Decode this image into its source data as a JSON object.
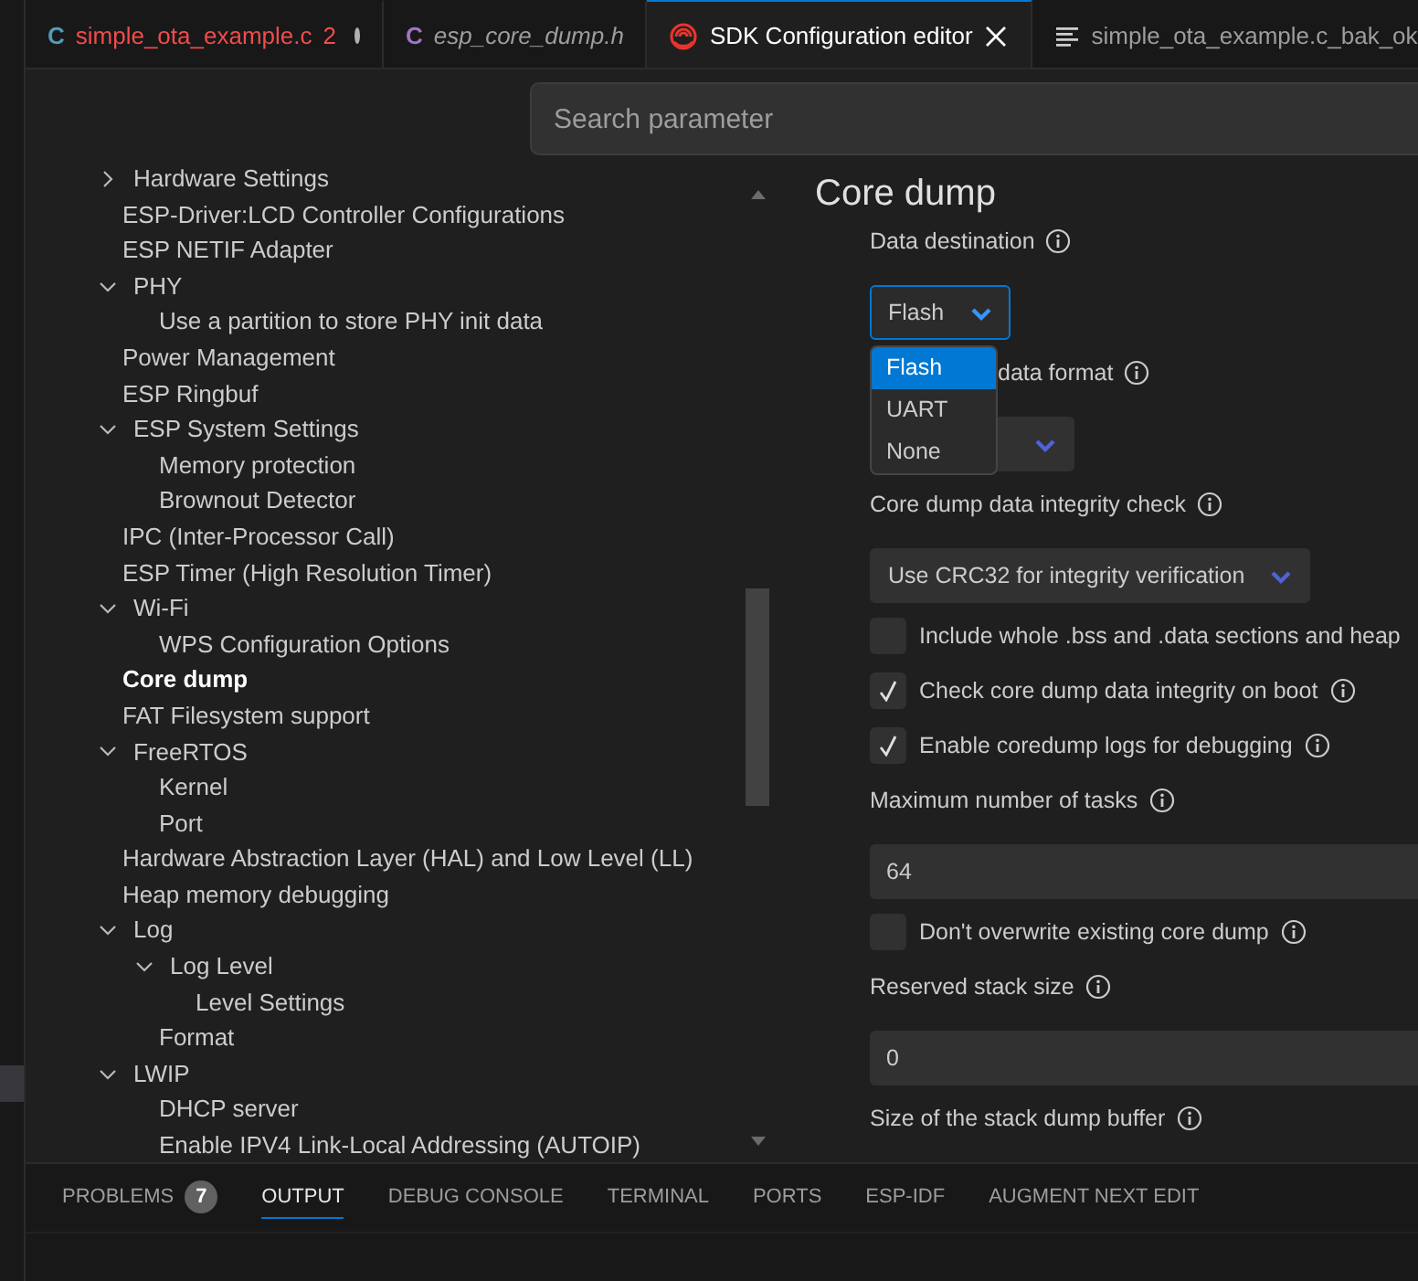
{
  "tabs": [
    {
      "kind": "source",
      "letter": "C",
      "color": "#519aba",
      "label": "simple_ota_example.c",
      "count": "2",
      "errors": true,
      "modified": true,
      "selected": false
    },
    {
      "kind": "source",
      "letter": "C",
      "color": "#a074c4",
      "label": "esp_core_dump.h",
      "preview": true,
      "selected": false
    },
    {
      "kind": "config",
      "label": "SDK Configuration editor",
      "closable": true,
      "selected": true
    },
    {
      "kind": "text",
      "label": "simple_ota_example.c_bak_ok",
      "selected": false
    }
  ],
  "search": {
    "placeholder": "Search parameter"
  },
  "tree": [
    {
      "label": "Hardware Settings",
      "expanded": false,
      "selected": false
    },
    {
      "label": "ESP-Driver:LCD Controller Configurations",
      "selected": false
    },
    {
      "label": "ESP NETIF Adapter",
      "selected": false
    },
    {
      "label": "PHY",
      "expanded": true,
      "selected": false,
      "children": [
        {
          "label": "Use a partition to store PHY init data",
          "selected": false
        }
      ]
    },
    {
      "label": "Power Management",
      "selected": false
    },
    {
      "label": "ESP Ringbuf",
      "selected": false
    },
    {
      "label": "ESP System Settings",
      "expanded": true,
      "selected": false,
      "children": [
        {
          "label": "Memory protection",
          "selected": false
        },
        {
          "label": "Brownout Detector",
          "selected": false
        }
      ]
    },
    {
      "label": "IPC (Inter-Processor Call)",
      "selected": false
    },
    {
      "label": "ESP Timer (High Resolution Timer)",
      "selected": false
    },
    {
      "label": "Wi-Fi",
      "expanded": true,
      "selected": false,
      "children": [
        {
          "label": "WPS Configuration Options",
          "selected": false
        }
      ]
    },
    {
      "label": "Core dump",
      "selected": true
    },
    {
      "label": "FAT Filesystem support",
      "selected": false
    },
    {
      "label": "FreeRTOS",
      "expanded": true,
      "selected": false,
      "children": [
        {
          "label": "Kernel",
          "selected": false
        },
        {
          "label": "Port",
          "selected": false
        }
      ]
    },
    {
      "label": "Hardware Abstraction Layer (HAL) and Low Level (LL)",
      "selected": false
    },
    {
      "label": "Heap memory debugging",
      "selected": false
    },
    {
      "label": "Log",
      "expanded": true,
      "selected": false,
      "children": [
        {
          "label": "Log Level",
          "expanded": true,
          "selected": false,
          "children": [
            {
              "label": "Level Settings",
              "selected": false
            }
          ]
        },
        {
          "label": "Format",
          "selected": false
        }
      ]
    },
    {
      "label": "LWIP",
      "expanded": true,
      "selected": false,
      "children": [
        {
          "label": "DHCP server",
          "selected": false
        },
        {
          "label": "Enable IPV4 Link-Local Addressing (AUTOIP)",
          "selected": false
        }
      ]
    }
  ],
  "section": {
    "title": "Core dump",
    "items": [
      {
        "kind": "select",
        "label": "Data destination",
        "info": true,
        "value": "Flash",
        "open": true,
        "options": [
          {
            "label": "Flash",
            "selected": true
          },
          {
            "label": "UART",
            "selected": false
          },
          {
            "label": "None",
            "selected": false
          }
        ]
      },
      {
        "kind": "select",
        "label": "data format",
        "info": true
      },
      {
        "kind": "select",
        "label": "Core dump data integrity check",
        "info": true,
        "value": "Use CRC32 for integrity verification"
      },
      {
        "kind": "checkbox",
        "label": "Include whole .bss and .data sections and heap",
        "checked": false
      },
      {
        "kind": "checkbox",
        "label": "Check core dump data integrity on boot",
        "info": true,
        "checked": true
      },
      {
        "kind": "checkbox",
        "label": "Enable coredump logs for debugging",
        "info": true,
        "checked": true
      },
      {
        "kind": "number",
        "label": "Maximum number of tasks",
        "info": true,
        "value": "64"
      },
      {
        "kind": "checkbox",
        "label": "Don't overwrite existing core dump",
        "info": true,
        "checked": false
      },
      {
        "kind": "number",
        "label": "Reserved stack size",
        "info": true,
        "value": "0"
      },
      {
        "kind": "label",
        "label": "Size of the stack dump buffer",
        "info": true
      }
    ]
  },
  "panel_tabs": [
    {
      "label": "PROBLEMS",
      "badge": "7",
      "selected": false
    },
    {
      "label": "OUTPUT",
      "selected": true
    },
    {
      "label": "DEBUG CONSOLE",
      "selected": false
    },
    {
      "label": "TERMINAL",
      "selected": false
    },
    {
      "label": "PORTS",
      "selected": false
    },
    {
      "label": "ESP-IDF",
      "selected": false
    },
    {
      "label": "AUGMENT NEXT EDIT",
      "selected": false
    }
  ]
}
